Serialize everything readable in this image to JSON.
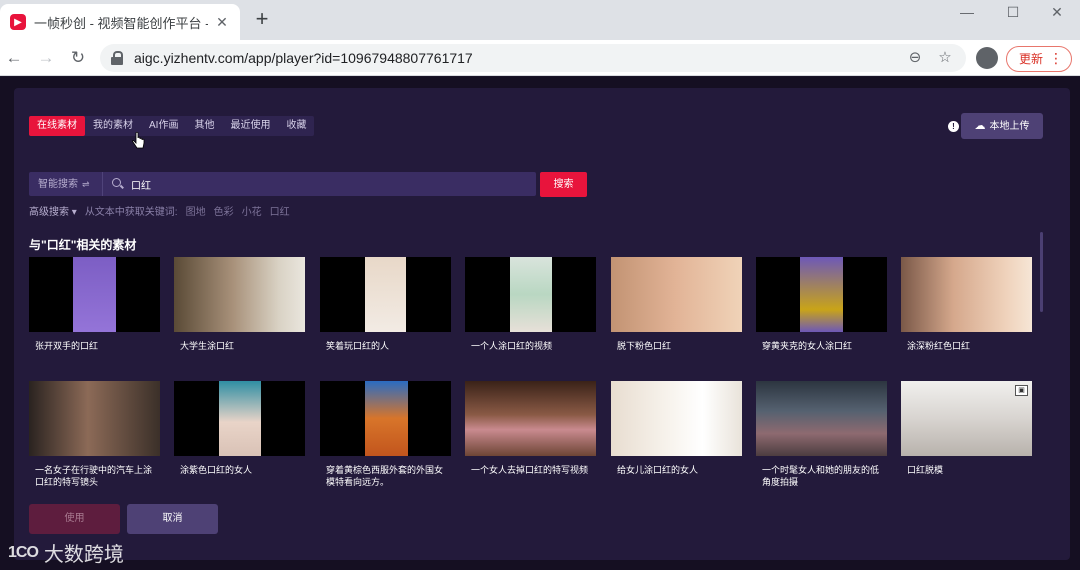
{
  "browser": {
    "tab_title": "一帧秒创 - 视频智能创作平台 - A",
    "url": "aigc.yizhentv.com/app/player?id=10967948807761717",
    "update_label": "更新"
  },
  "modal": {
    "tabs": [
      {
        "label": "在线素材",
        "active": true
      },
      {
        "label": "我的素材"
      },
      {
        "label": "AI作画"
      },
      {
        "label": "其他"
      },
      {
        "label": "最近使用"
      },
      {
        "label": "收藏"
      }
    ],
    "upload_label": "本地上传",
    "search": {
      "mode_label": "智能搜索",
      "query": "口红",
      "button_label": "搜索"
    },
    "advanced": {
      "label": "高级搜索",
      "hint": "从文本中获取关键词:",
      "keywords": [
        "图地",
        "色彩",
        "小花",
        "口红"
      ]
    },
    "section_title": "与\"口红\"相关的素材",
    "items": [
      {
        "caption": "张开双手的口红",
        "scheme": "purple-center"
      },
      {
        "caption": "大学生涂口红",
        "scheme": "full-warm"
      },
      {
        "caption": "笑着玩口红的人",
        "scheme": "narrow-white"
      },
      {
        "caption": "一个人涂口红的视频",
        "scheme": "narrow-green"
      },
      {
        "caption": "脱下粉色口红",
        "scheme": "full-skin"
      },
      {
        "caption": "穿黄夹克的女人涂口红",
        "scheme": "narrow-violet"
      },
      {
        "caption": "涂深粉红色口红",
        "scheme": "full-makeup"
      },
      {
        "caption": "一名女子在行驶中的汽车上涂口红的特写镜头",
        "scheme": "full-dark"
      },
      {
        "caption": "涂紫色口红的女人",
        "scheme": "narrow-teal"
      },
      {
        "caption": "穿着黄棕色西服外套的外国女模特看向远方。",
        "scheme": "narrow-orange"
      },
      {
        "caption": "一个女人去掉口红的特写视频",
        "scheme": "full-lips"
      },
      {
        "caption": "给女儿涂口红的女人",
        "scheme": "full-bright"
      },
      {
        "caption": "一个时髦女人和她的朋友的低角度拍摄",
        "scheme": "full-wheel"
      },
      {
        "caption": "口红脱模",
        "scheme": "full-lab"
      }
    ],
    "use_label": "使用",
    "cancel_label": "取消"
  },
  "watermark": {
    "logo": "1CO",
    "text": "大数跨境"
  }
}
